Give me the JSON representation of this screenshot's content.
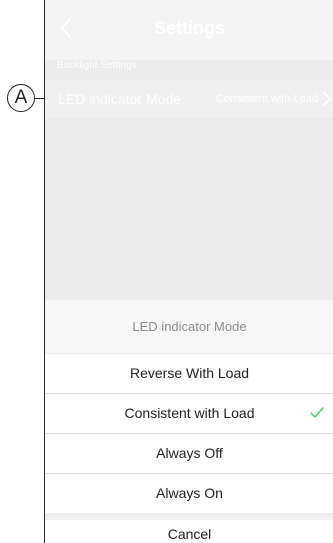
{
  "callout": {
    "letter": "A"
  },
  "header": {
    "title": "Settings",
    "back_icon": "chevron-left-icon"
  },
  "section": {
    "label": "Backlight Settings"
  },
  "setting": {
    "label": "LED indicator Mode",
    "value": "Consistent with Load",
    "chevron_icon": "chevron-right-icon"
  },
  "sheet": {
    "title": "LED indicator Mode",
    "options": [
      {
        "label": "Reverse With Load",
        "selected": false
      },
      {
        "label": "Consistent with Load",
        "selected": true
      },
      {
        "label": "Always Off",
        "selected": false
      },
      {
        "label": "Always On",
        "selected": false
      }
    ],
    "cancel_label": "Cancel",
    "check_color": "#3dcd58"
  }
}
